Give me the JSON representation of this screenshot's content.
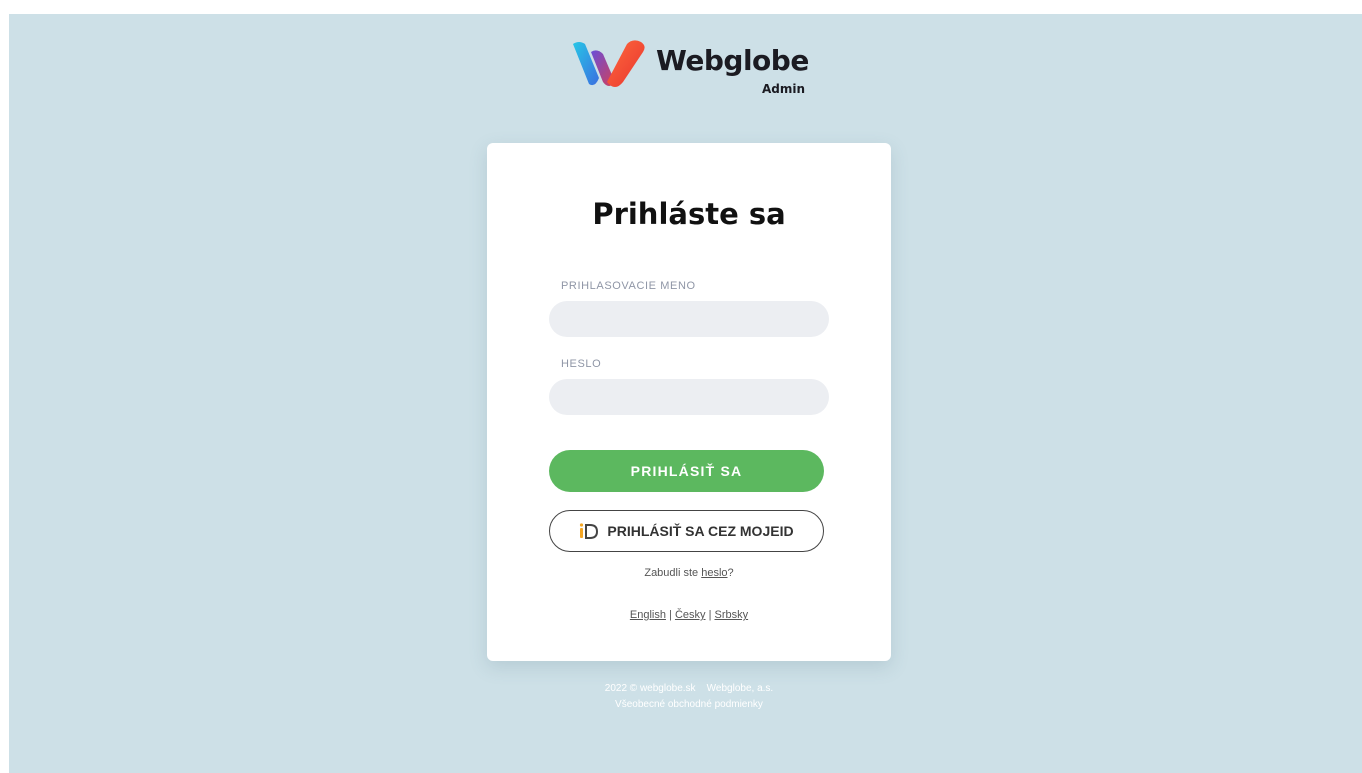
{
  "brand": {
    "name": "Webglobe",
    "subtitle": "Admin"
  },
  "login": {
    "title": "Prihláste sa",
    "username_label": "PRIHLASOVACIE MENO",
    "username_value": "",
    "password_label": "HESLO",
    "password_value": "",
    "submit_label": "PRIHLÁSIŤ SA",
    "mojeid_label": "PRIHLÁSIŤ SA CEZ MOJEID",
    "forgot_prefix": "Zabudli ste ",
    "forgot_link": "heslo",
    "forgot_suffix": "?"
  },
  "languages": [
    "English",
    "Česky",
    "Srbsky"
  ],
  "footer": {
    "line1_copyright": "2022 © webglobe.sk",
    "line1_company": "Webglobe, a.s.",
    "line2": "Všeobecné obchodné podmienky"
  },
  "colors": {
    "background": "#cde0e7",
    "primary_button": "#5cb85f",
    "input_bg": "#eceef2",
    "mojeid_accent": "#f5a623"
  }
}
